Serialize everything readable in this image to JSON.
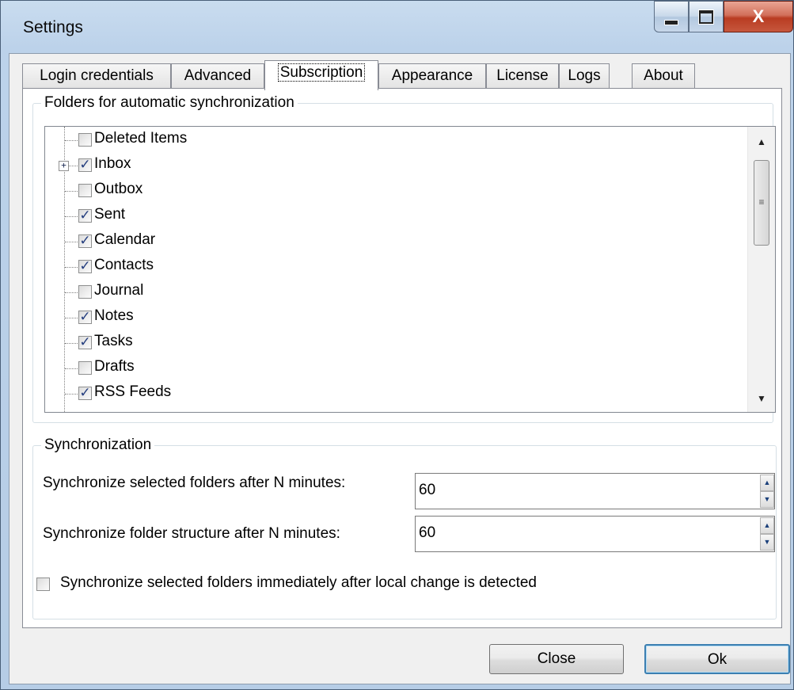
{
  "window": {
    "title": "Settings"
  },
  "tabs": [
    {
      "label": "Login credentials",
      "active": false
    },
    {
      "label": "Advanced",
      "active": false
    },
    {
      "label": "Subscription",
      "active": true
    },
    {
      "label": "Appearance",
      "active": false
    },
    {
      "label": "License",
      "active": false
    },
    {
      "label": "Logs",
      "active": false
    },
    {
      "label": "About",
      "active": false
    }
  ],
  "folders_group": {
    "legend": "Folders for automatic synchronization",
    "items": [
      {
        "label": "Deleted Items",
        "checked": false,
        "expandable": false
      },
      {
        "label": "Inbox",
        "checked": true,
        "expandable": true,
        "expander": "+"
      },
      {
        "label": "Outbox",
        "checked": false,
        "expandable": false
      },
      {
        "label": "Sent",
        "checked": true,
        "expandable": false
      },
      {
        "label": "Calendar",
        "checked": true,
        "expandable": false
      },
      {
        "label": "Contacts",
        "checked": true,
        "expandable": false
      },
      {
        "label": "Journal",
        "checked": false,
        "expandable": false
      },
      {
        "label": "Notes",
        "checked": true,
        "expandable": false
      },
      {
        "label": "Tasks",
        "checked": true,
        "expandable": false
      },
      {
        "label": "Drafts",
        "checked": false,
        "expandable": false
      },
      {
        "label": "RSS Feeds",
        "checked": true,
        "expandable": false
      }
    ]
  },
  "sync_group": {
    "legend": "Synchronization",
    "selected_folders_label": "Synchronize selected folders after N minutes:",
    "selected_folders_value": "60",
    "structure_label": "Synchronize folder structure after N minutes:",
    "structure_value": "60",
    "immediate_label": "Synchronize selected folders immediately after local change is detected",
    "immediate_checked": false
  },
  "buttons": {
    "close": "Close",
    "ok": "Ok"
  },
  "icons": {
    "minimize": "minimize-icon",
    "maximize": "maximize-icon",
    "close": "close-icon",
    "check": "✓"
  }
}
